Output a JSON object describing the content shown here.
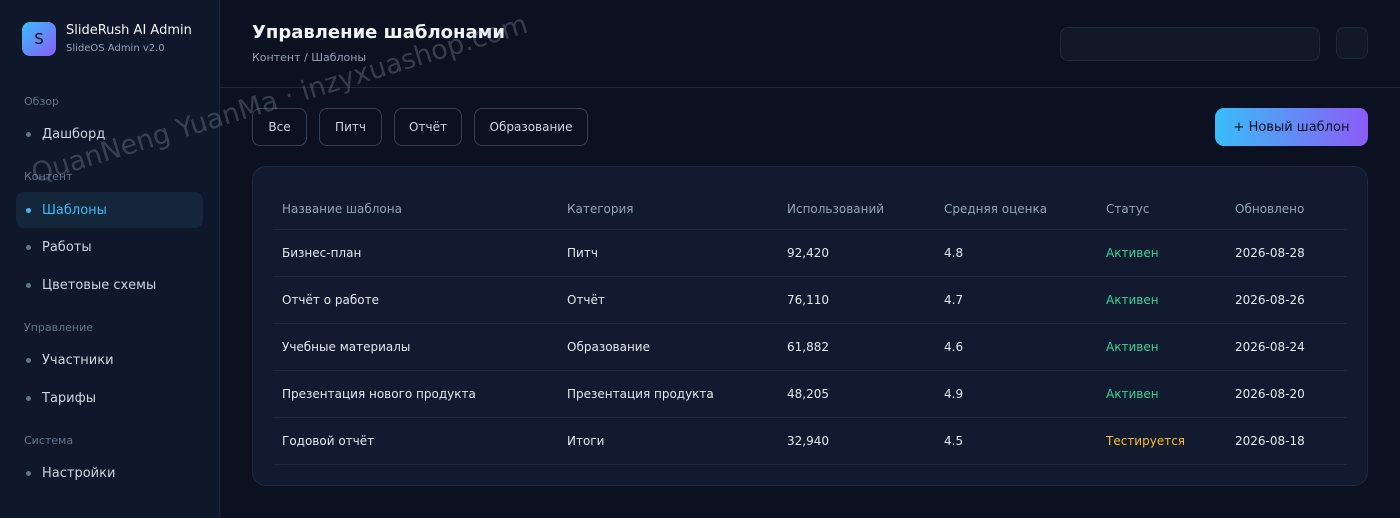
{
  "brand": {
    "logo_letter": "S",
    "name": "SlideRush AI Admin",
    "subtitle": "SlideOS Admin v2.0"
  },
  "sidebar": {
    "sections": [
      {
        "label": "Обзор",
        "items": [
          {
            "label": "Дашборд",
            "active": false
          }
        ]
      },
      {
        "label": "Контент",
        "items": [
          {
            "label": "Шаблоны",
            "active": true
          },
          {
            "label": "Работы",
            "active": false
          },
          {
            "label": "Цветовые схемы",
            "active": false
          }
        ]
      },
      {
        "label": "Управление",
        "items": [
          {
            "label": "Участники",
            "active": false
          },
          {
            "label": "Тарифы",
            "active": false
          }
        ]
      },
      {
        "label": "Система",
        "items": [
          {
            "label": "Настройки",
            "active": false
          }
        ]
      }
    ]
  },
  "header": {
    "title": "Управление шаблонами",
    "breadcrumb": "Контент / Шаблоны",
    "search_value": "",
    "search_placeholder": ""
  },
  "filters": [
    "Все",
    "Питч",
    "Отчёт",
    "Образование"
  ],
  "new_button": "+ Новый шаблон",
  "table": {
    "columns": [
      "Название шаблона",
      "Категория",
      "Использований",
      "Средняя оценка",
      "Статус",
      "Обновлено"
    ],
    "rows": [
      [
        "Бизнес-план",
        "Питч",
        "92,420",
        "4.8",
        "Активен",
        "2026-08-28"
      ],
      [
        "Отчёт о работе",
        "Отчёт",
        "76,110",
        "4.7",
        "Активен",
        "2026-08-26"
      ],
      [
        "Учебные материалы",
        "Образование",
        "61,882",
        "4.6",
        "Активен",
        "2026-08-24"
      ],
      [
        "Презентация нового продукта",
        "Презентация продукта",
        "48,205",
        "4.9",
        "Активен",
        "2026-08-20"
      ],
      [
        "Годовой отчёт",
        "Итоги",
        "32,940",
        "4.5",
        "Тестируется",
        "2026-08-18"
      ]
    ]
  },
  "status_colors": {
    "Активен": "#34d399",
    "Тестируется": "#fbbf24"
  },
  "colors": {
    "accent": "#38bdf8",
    "accent_end": "#8b5cf6",
    "background": "#0b1120",
    "sidebar": "#0f172a"
  },
  "watermark": "QuanNeng YuanMa · inzyxuashop.com"
}
